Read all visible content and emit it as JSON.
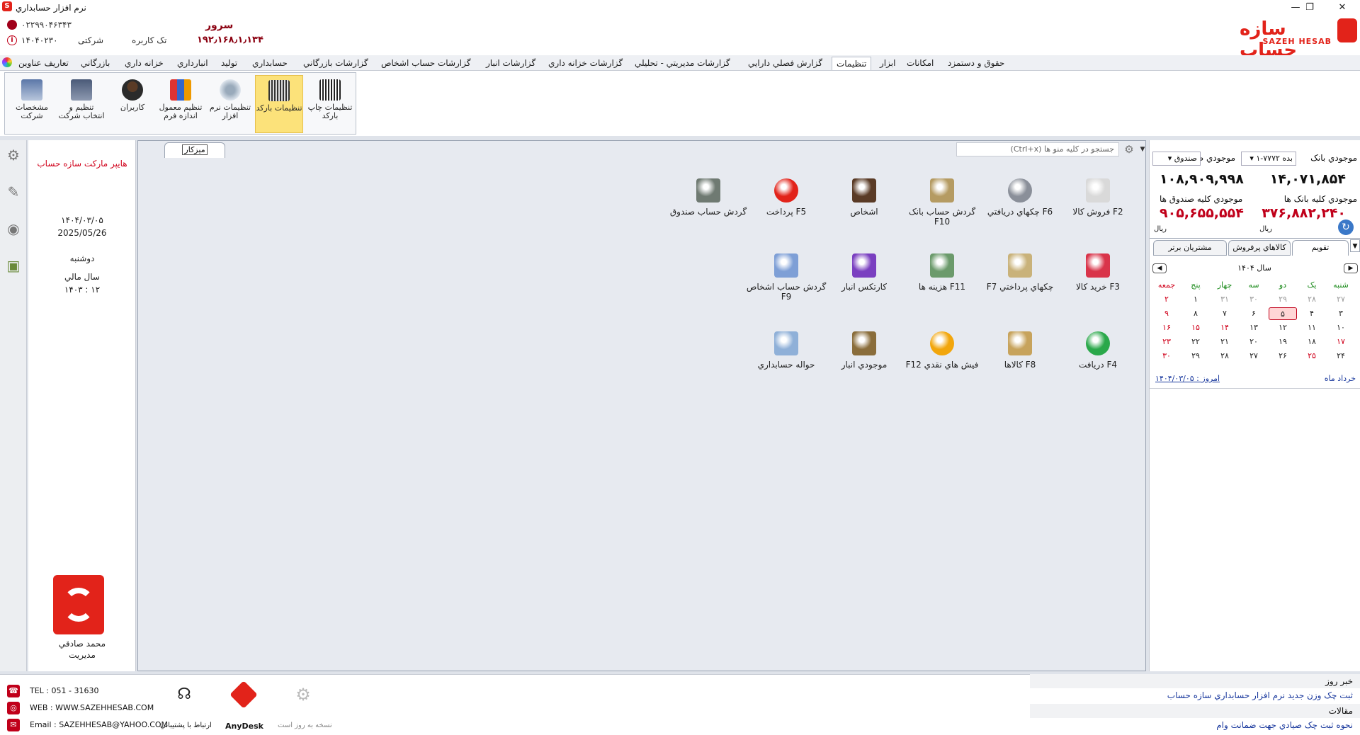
{
  "window": {
    "title": "نرم افزار حسابداري",
    "minimize": "—",
    "restore": "❐",
    "close": "✕"
  },
  "header": {
    "phone": "۰۲۲۹۹۰۴۶۳۴۳",
    "date_code": "۱۴۰۴۰۲۳۰",
    "company_type": "شرکتی",
    "user_mode": "تک کاربره",
    "server_label": "سرور",
    "server_ip": "۱۹۲٫۱۶۸٫۱٫۱۳۴",
    "logo_fa": "سازه حساب",
    "logo_en": "SAZEH HESAB"
  },
  "menu": [
    "حقوق و دستمزد",
    "امکانات",
    "ابزار",
    "تنظيمات",
    "گزارش فصلي دارايي",
    "گزارشات مديريتي - تحليلي",
    "گزارشات خزانه داري",
    "گزارشات انبار",
    "گزارشات حساب اشخاص",
    "گزارشات بازرگاني",
    "حسابداري",
    "توليد",
    "انبارداري",
    "خزانه داري",
    "بازرگاني",
    "تعاريف عناوين"
  ],
  "ribbon": [
    "تنظيمات چاپ بارکد",
    "تنظيمات بارکد",
    "تنظيمات نرم افزار",
    "تنظيم معمول اندازه فرم",
    "کاربران",
    "تنظيم و انتخاب شرکت",
    "مشخصات شرکت"
  ],
  "leftinfo": {
    "company": "هايپر مارکت سازه حساب",
    "date_fa": "۱۴۰۴/۰۳/۰۵",
    "date_en": "2025/05/26",
    "weekday": "دوشنبه",
    "fiscal_label": "سال مالي",
    "fiscal_year": "۱۴۰۳ : ۱۲",
    "user_name": "محمد صادقي",
    "user_role": "مديريت"
  },
  "desktop": {
    "tab": "ميزکار",
    "search_placeholder": "جستجو در کليه منو ها  (Ctrl+x)",
    "items": [
      {
        "label": "F2   فروش کالا",
        "icon": "sale-icon",
        "color": "#d9d9d9"
      },
      {
        "label": "F6   چکهاي دريافتي",
        "icon": "received-cheque-icon",
        "color": "#8a8f99"
      },
      {
        "label": "گردش حساب بانک F10",
        "icon": "bank-icon",
        "color": "#b59b62"
      },
      {
        "label": "اشخاص",
        "icon": "person-icon",
        "color": "#5a3b26"
      },
      {
        "label": "F5   پرداخت",
        "icon": "payment-icon",
        "color": "#e2231a"
      },
      {
        "label": "گردش حساب صندوق",
        "icon": "safe-icon",
        "color": "#6f7a72"
      },
      {
        "label": "F3   خريد کالا",
        "icon": "purchase-icon",
        "color": "#d9344a"
      },
      {
        "label": "چکهاي پرداختي F7",
        "icon": "paid-cheque-icon",
        "color": "#c9b27a"
      },
      {
        "label": "F11   هزينه ها",
        "icon": "expense-icon",
        "color": "#6b9a6b"
      },
      {
        "label": "کارتکس انبار",
        "icon": "cardex-icon",
        "color": "#7a3fc0"
      },
      {
        "label": "گردش حساب اشخاص F9",
        "icon": "persons-account-icon",
        "color": "#7e9fd6"
      },
      {
        "label": "F4   دريافت",
        "icon": "receive-icon",
        "color": "#2aa84a"
      },
      {
        "label": "F8   کالاها",
        "icon": "goods-icon",
        "color": "#c7a35c"
      },
      {
        "label": "فيش هاي نقدي F12",
        "icon": "cash-slip-icon",
        "color": "#f2a60c"
      },
      {
        "label": "موجودي انبار",
        "icon": "stock-icon",
        "color": "#8a6d3b"
      },
      {
        "label": "حواله حسابداري",
        "icon": "voucher-icon",
        "color": "#8fb0d8"
      }
    ]
  },
  "rightpanel": {
    "bank_label": "موجودي بانک",
    "bank_select": "بده ۷۷۷۲-۱",
    "cash_label": "موجودي صندوق",
    "cash_select": "صندوق",
    "bank_value": "۱۴,۰۷۱,۸۵۴",
    "cash_value": "۱۰۸,۹۰۹,۹۹۸",
    "all_banks_label": "موجودي کليه بانک ها",
    "all_cash_label": "موجودي کليه صندوق ها",
    "all_banks_value": "۳۷۶,۸۸۲,۲۴۰",
    "all_cash_value": "۹۰۵,۶۵۵,۵۵۴",
    "currency": "ريال",
    "tabs": [
      "تقويم",
      "کالاهاي پرفروش",
      "مشتريان برتر"
    ],
    "year_label": "سال ۱۴۰۴",
    "weekdays": [
      "شنبه",
      "يک",
      "دو",
      "سه",
      "چهار",
      "پنج",
      "جمعه"
    ],
    "weeks": [
      [
        "۲۷",
        "۲۸",
        "۲۹",
        "۳۰",
        "۳۱",
        "۱",
        "۲"
      ],
      [
        "۳",
        "۴",
        "۵",
        "۶",
        "۷",
        "۸",
        "۹"
      ],
      [
        "۱۰",
        "۱۱",
        "۱۲",
        "۱۳",
        "۱۴",
        "۱۵",
        "۱۶"
      ],
      [
        "۱۷",
        "۱۸",
        "۱۹",
        "۲۰",
        "۲۱",
        "۲۲",
        "۲۳"
      ],
      [
        "۲۴",
        "۲۵",
        "۲۶",
        "۲۷",
        "۲۸",
        "۲۹",
        "۳۰"
      ]
    ],
    "month_label": "خرداد ماه",
    "today_label": "امروز : ۱۴۰۴/۰۳/۰۵"
  },
  "footer": {
    "tel": "TEL : 051 - 31630",
    "web": "WEB : WWW.SAZEHHESAB.COM",
    "email": "Email : SAZEHHESAB@YAHOO.COM",
    "support": "ارتباط با پشتيباني",
    "anydesk": "AnyDesk",
    "updated": "نسخه به روز است"
  },
  "news": {
    "head1": "خبر روز",
    "link1": "ثبت چک وزن جديد نرم افزار حسابداري سازه حساب",
    "head2": "مقالات",
    "link2": "نحوه ثبت چک صيادي جهت ضمانت وام"
  }
}
